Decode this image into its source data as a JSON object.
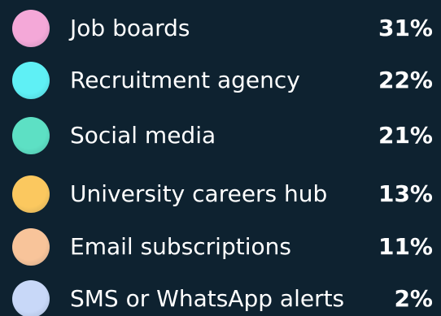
{
  "chart_data": {
    "type": "table",
    "title": "",
    "rows": [
      {
        "label": "Job boards",
        "value": 31,
        "display": "31%",
        "color": "#f4a8d8"
      },
      {
        "label": "Recruitment agency",
        "value": 22,
        "display": "22%",
        "color": "#5ff0f5"
      },
      {
        "label": "Social media",
        "value": 21,
        "display": "21%",
        "color": "#5de0c4"
      },
      {
        "label": "University careers hub",
        "value": 13,
        "display": "13%",
        "color": "#fbc85f"
      },
      {
        "label": "Email subscriptions",
        "value": 11,
        "display": "11%",
        "color": "#f8c49a"
      },
      {
        "label": "SMS or WhatsApp alerts",
        "value": 2,
        "display": "2%",
        "color": "#c8d8f8"
      }
    ]
  },
  "colors": {
    "background": "#0e2230",
    "text": "#ffffff"
  }
}
